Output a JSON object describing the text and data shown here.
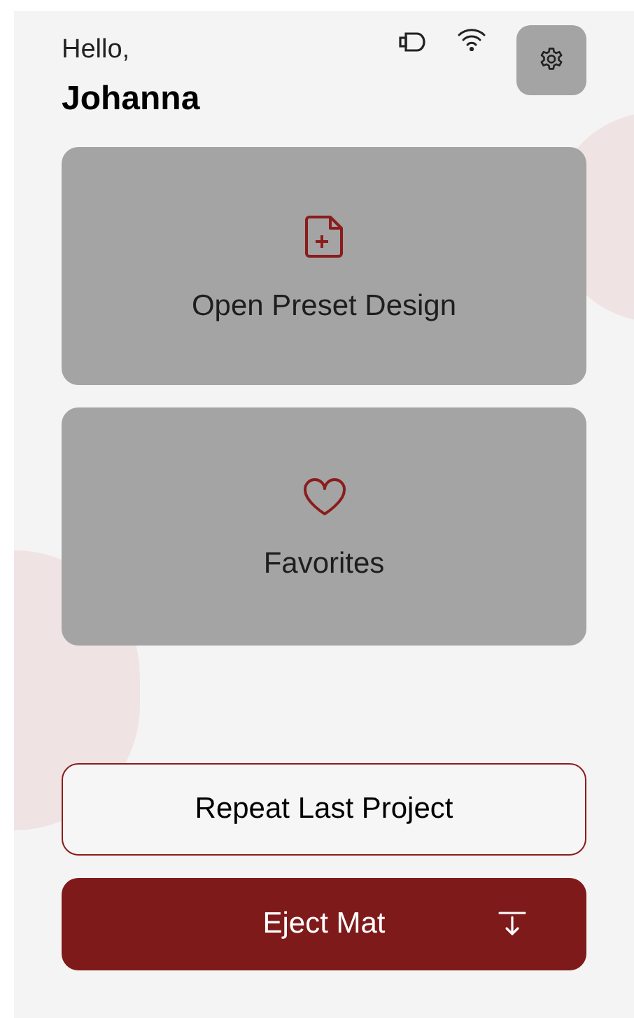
{
  "header": {
    "greeting": "Hello,",
    "user_name": "Johanna"
  },
  "cards": [
    {
      "label": "Open Preset Design",
      "kind": "file"
    },
    {
      "label": "Favorites",
      "kind": "heart"
    }
  ],
  "actions": [
    {
      "label": "Repeat Last Project",
      "kind": "outline"
    },
    {
      "label": "Eject Mat",
      "kind": "eject"
    }
  ]
}
